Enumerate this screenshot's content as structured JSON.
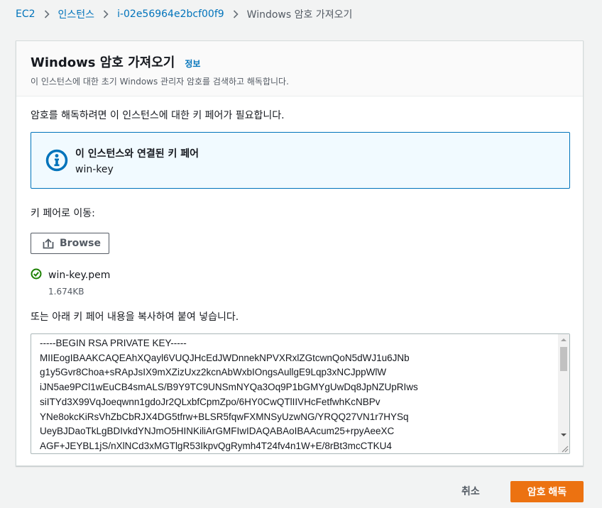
{
  "breadcrumb": {
    "items": [
      "EC2",
      "인스턴스",
      "i-02e56964e2bcf00f9"
    ],
    "current": "Windows 암호 가져오기"
  },
  "panel": {
    "title": "Windows 암호 가져오기",
    "info_link": "정보",
    "description": "이 인스턴스에 대한 초기 Windows 관리자 암호를 검색하고 해독합니다.",
    "instruction": "암호를 해독하려면 이 인스턴스에 대한 키 페어가 필요합니다.",
    "alert": {
      "title": "이 인스턴스와 연결된 키 페어",
      "value": "win-key"
    },
    "navigate_label": "키 페어로 이동:",
    "browse_label": "Browse",
    "file": {
      "name": "win-key.pem",
      "size": "1.674KB"
    },
    "paste_label": "또는 아래 키 페어 내용을 복사하여 붙여 넣습니다.",
    "key_content": "-----BEGIN RSA PRIVATE KEY-----\nMIIEogIBAAKCAQEAhXQayl6VUQJHcEdJWDnnekNPVXRxlZGtcwnQoN5dWJ1u6JNb\ng1y5Gvr8Choa+sRApJsIX9mXZizUxz2kcnAbWxbIOngsAullgE9Lqp3xNCJppWlW\niJN5ae9PCl1wEuCB4smALS/B9Y9TC9UNSmNYQa3Oq9P1bGMYgUwDq8JpNZUpRIws\nsiITYd3X99VqJoeqwnn1gdoJr2QLxbfCpmZpo/6HY0CwQTlIIVHcFetfwhKcNBPv\nYNe8okcKiRsVhZbCbRJX4DG5tfrw+BLSR5fqwFXMNSyUzwNG/YRQQ27VN1r7HYSq\nUeyBJDaoTkLgBDIvkdYNJmO5HINKiliArGMFIwIDAQABAoIBAAcum25+rpyAeeXC\nAGF+JEYBL1jS/nXlNCd3xMGTlgR53IkpvQgRymh4T24fv4n1W+E/8rBt3mcCTKU4"
  },
  "footer": {
    "cancel_label": "취소",
    "submit_label": "암호 해독"
  },
  "colors": {
    "link": "#0073bb",
    "primary": "#ec7211",
    "success": "#1d8102",
    "info_bg": "#f1faff"
  },
  "icons": [
    "chevron-right-icon",
    "info-icon",
    "upload-icon",
    "success-check-icon",
    "scroll-up-icon",
    "scroll-down-icon",
    "resize-grip-icon"
  ]
}
